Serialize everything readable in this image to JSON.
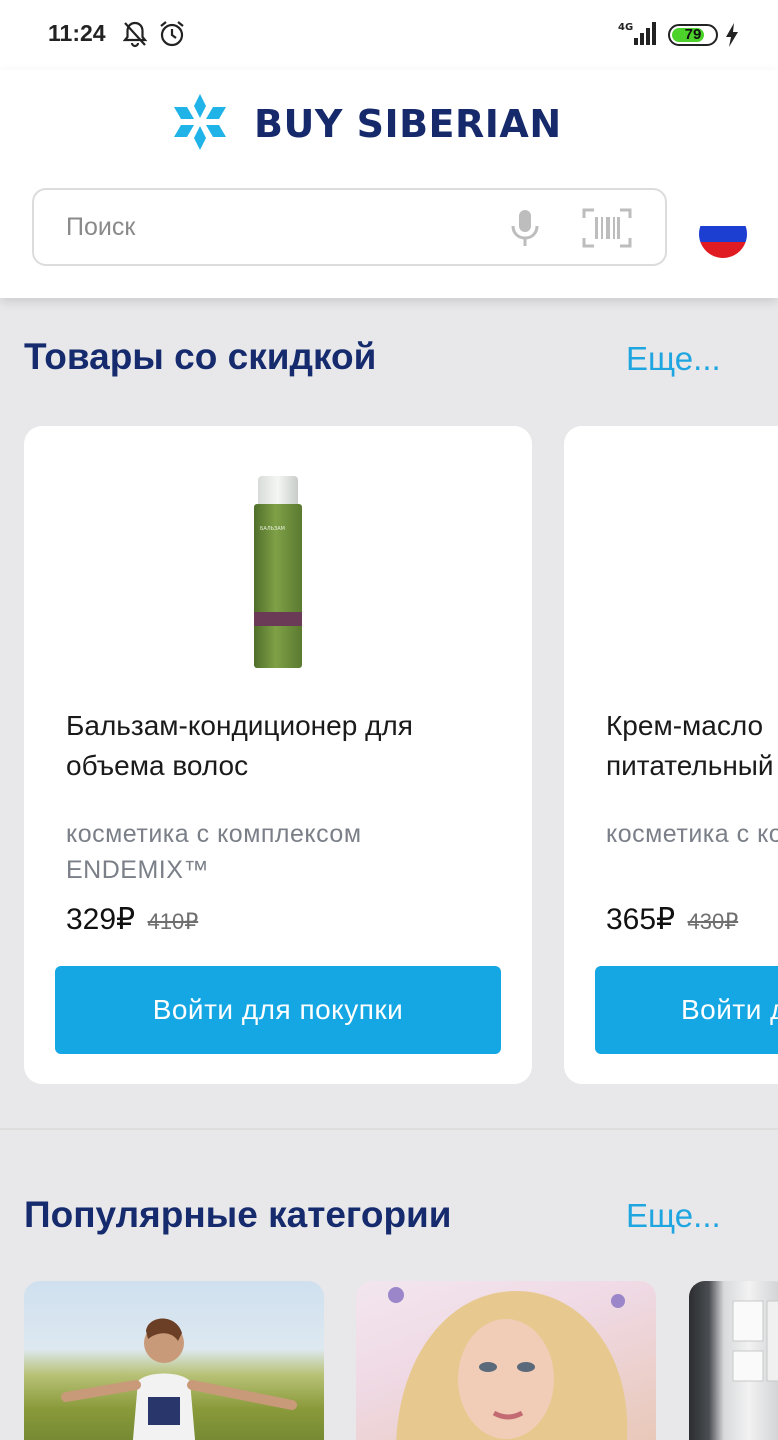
{
  "status_bar": {
    "time": "11:24",
    "network": "4G",
    "battery": "79",
    "battery_level": 0.79,
    "icons": [
      "bell-off-icon",
      "alarm-icon",
      "signal-icon",
      "battery-icon",
      "charging-icon"
    ]
  },
  "header": {
    "logo_text_1": "Buy",
    "logo_text_2": "Siberian",
    "search_placeholder": "Поиск",
    "icons": [
      "mic-icon",
      "barcode-scan-icon",
      "russia-flag-icon"
    ]
  },
  "colors": {
    "brand_navy": "#152b6e",
    "accent_blue": "#14a7e3",
    "link_blue": "#1fa6e0",
    "background": "#e8e8ea"
  },
  "discount_section": {
    "title": "Товары со скидкой",
    "more": "Еще...",
    "products": [
      {
        "name": "Бальзам-кондиционер для объема волос",
        "subtitle": "косметика с комплексом ENDEMIX™",
        "price": "329₽",
        "old_price": "410₽",
        "button": "Войти для покупки",
        "bottle_label": "БАЛЬЗАМ"
      },
      {
        "name": "Крем-масло питательный",
        "subtitle": "косметика с комплексом ENDEMIX™",
        "price": "365₽",
        "old_price": "430₽",
        "button": "Войти для покупки"
      }
    ]
  },
  "categories_section": {
    "title": "Популярные категории",
    "more": "Еще..."
  }
}
